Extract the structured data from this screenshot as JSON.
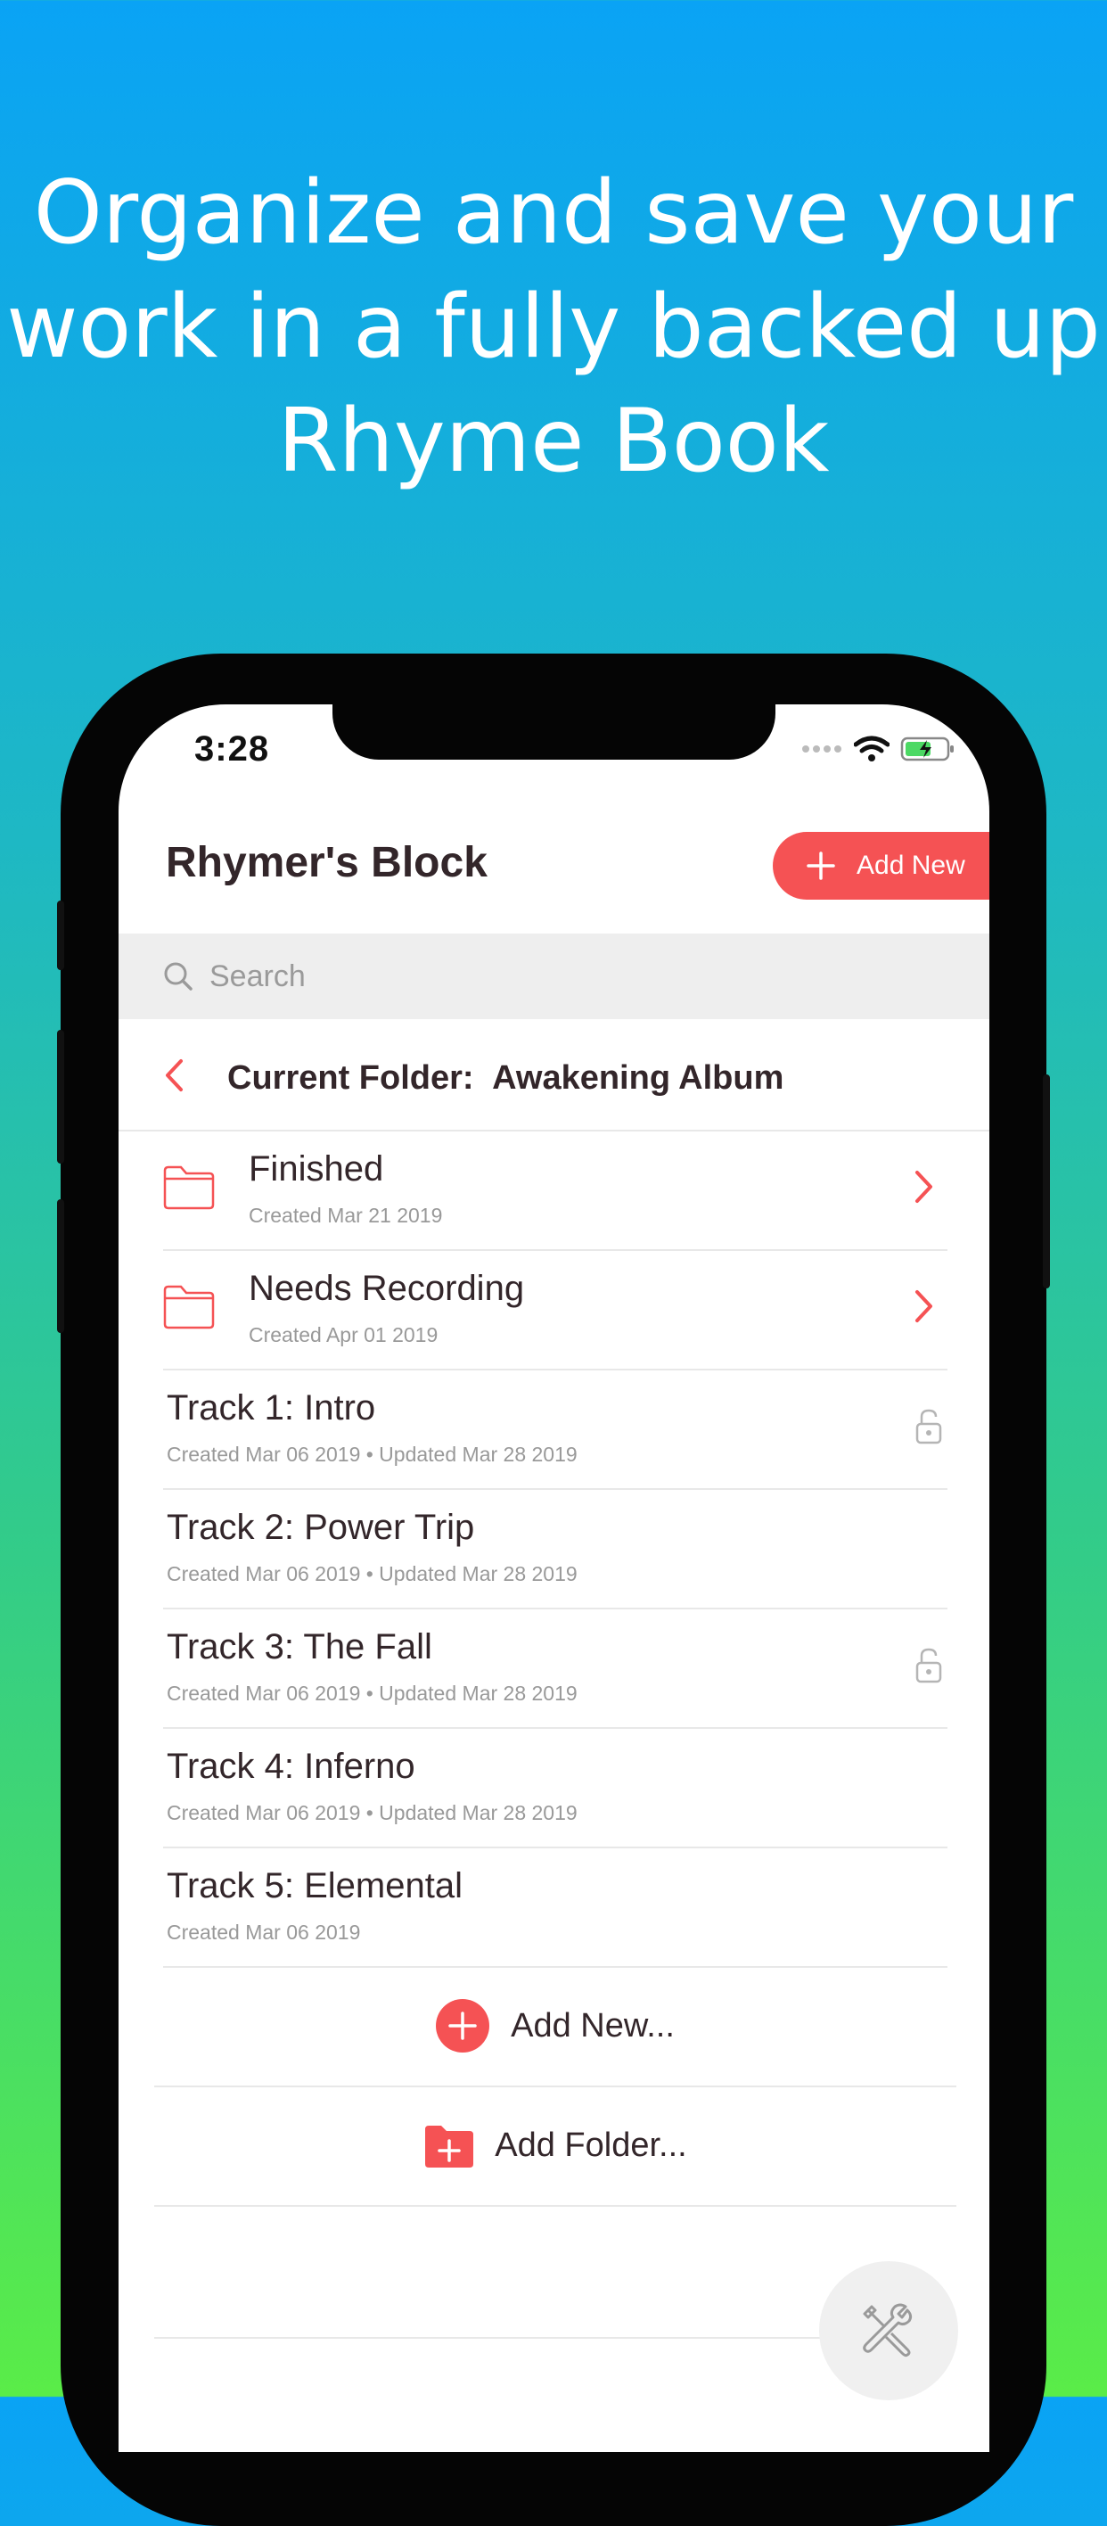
{
  "headline": {
    "line1": "Organize and save your",
    "line2": "work in a fully backed up",
    "line3": "Rhyme Book"
  },
  "status_bar": {
    "time": "3:28"
  },
  "header": {
    "title": "Rhymer's Block",
    "add_new_label": "Add New"
  },
  "search": {
    "placeholder": "Search"
  },
  "current_folder": {
    "label": "Current Folder:",
    "name": "Awakening Album"
  },
  "folders": [
    {
      "title": "Finished",
      "subtitle": "Created Mar 21 2019"
    },
    {
      "title": "Needs Recording",
      "subtitle": "Created Apr 01 2019"
    }
  ],
  "tracks": [
    {
      "title": "Track 1: Intro",
      "subtitle": "Created Mar 06 2019 • Updated Mar 28 2019",
      "locked": true
    },
    {
      "title": "Track 2: Power Trip",
      "subtitle": "Created Mar 06 2019 • Updated Mar 28 2019",
      "locked": false
    },
    {
      "title": "Track 3: The Fall",
      "subtitle": "Created Mar 06 2019 • Updated Mar 28 2019",
      "locked": true
    },
    {
      "title": "Track 4: Inferno",
      "subtitle": "Created Mar 06 2019 • Updated Mar 28 2019",
      "locked": false
    },
    {
      "title": "Track 5: Elemental",
      "subtitle": "Created Mar 06 2019",
      "locked": false
    }
  ],
  "actions": {
    "add_new": "Add New...",
    "add_folder": "Add Folder..."
  },
  "colors": {
    "accent": "#f55254",
    "text": "#33262a",
    "muted": "#999999"
  }
}
